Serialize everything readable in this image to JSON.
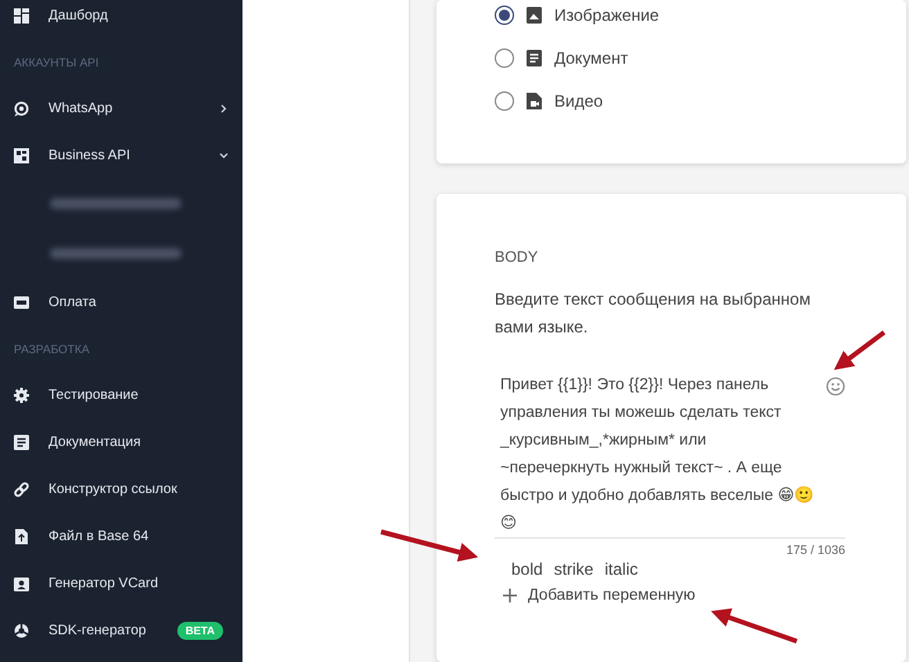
{
  "sidebar": {
    "items": [
      {
        "kind": "item",
        "label": "Дашборд"
      },
      {
        "kind": "section",
        "label": "АККАУНТЫ API"
      },
      {
        "kind": "item",
        "label": "WhatsApp",
        "expanded": false
      },
      {
        "kind": "item",
        "label": "Business API",
        "expanded": true
      },
      {
        "kind": "blurred"
      },
      {
        "kind": "blurred"
      },
      {
        "kind": "item",
        "label": "Оплата"
      },
      {
        "kind": "section",
        "label": "РАЗРАБОТКА"
      },
      {
        "kind": "item",
        "label": "Тестирование"
      },
      {
        "kind": "item",
        "label": "Документация"
      },
      {
        "kind": "item",
        "label": "Конструктор ссылок"
      },
      {
        "kind": "item",
        "label": "Файл в Base 64"
      },
      {
        "kind": "item",
        "label": "Генератор VCard"
      },
      {
        "kind": "item",
        "label": "SDK-генератор",
        "badge": "BETA"
      }
    ]
  },
  "media_card": {
    "options": [
      {
        "label": "Изображение",
        "selected": true
      },
      {
        "label": "Документ",
        "selected": false
      },
      {
        "label": "Видео",
        "selected": false
      }
    ]
  },
  "body_card": {
    "title": "BODY",
    "hint": "Введите текст сообщения на выбранном вами языке.",
    "message": "Привет {{1}}! Это {{2}}! Через панель управления ты можешь сделать текст _курсивным_,*жирным*  или ~перечеркнуть нужный текст~ . А еще быстро и удобно добавлять веселые 😁🙂 😊",
    "counter": "175 / 1036",
    "formats": [
      "bold",
      "strike",
      "italic"
    ],
    "add_variable": "Добавить переменную"
  }
}
